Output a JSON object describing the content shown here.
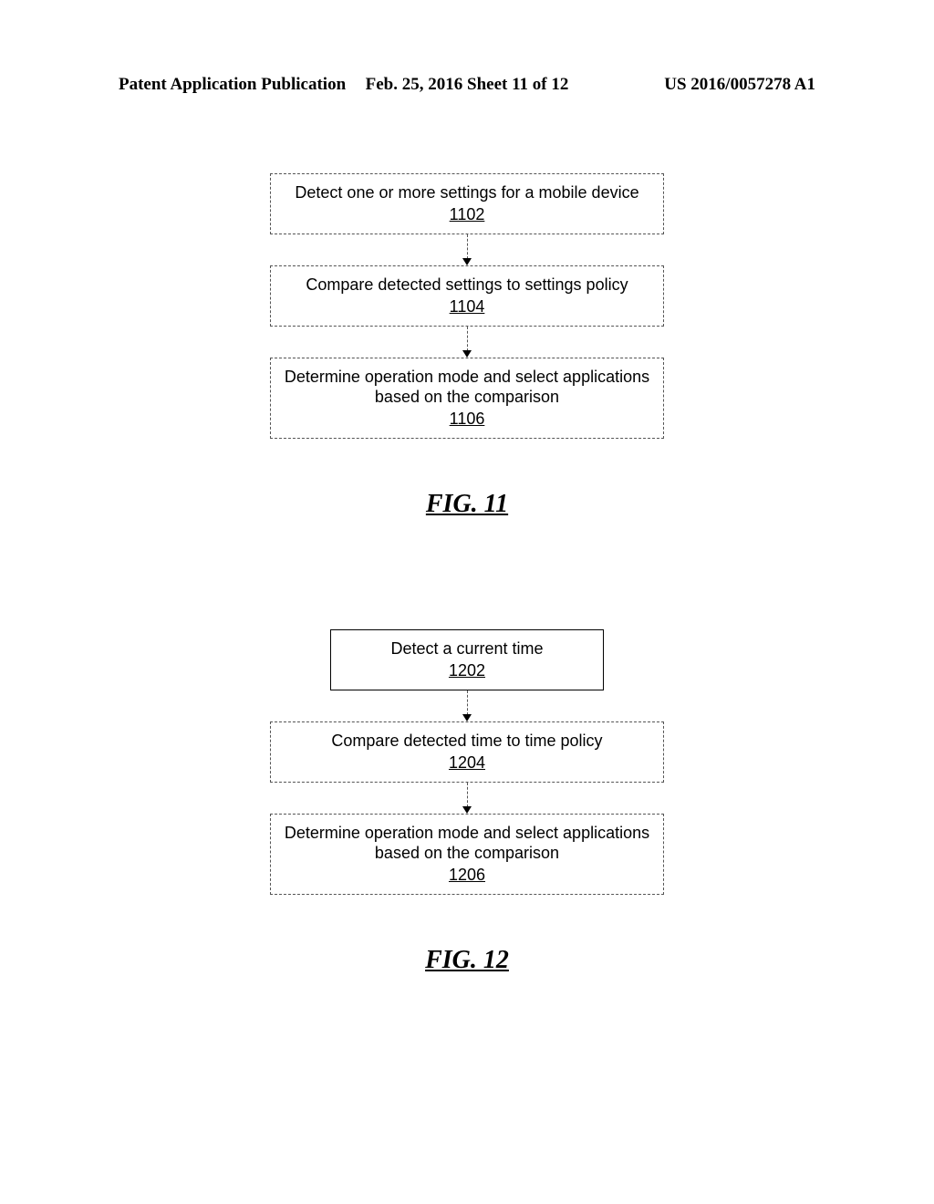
{
  "header": {
    "left": "Patent Application Publication",
    "center": "Feb. 25, 2016  Sheet 11 of 12",
    "right": "US 2016/0057278 A1"
  },
  "fig11": {
    "label": "FIG. 11",
    "steps": [
      {
        "text": "Detect one or more settings for a mobile device",
        "num": "1102"
      },
      {
        "text": "Compare detected settings to settings policy",
        "num": "1104"
      },
      {
        "text": "Determine operation mode and select applications based on the comparison",
        "num": "1106"
      }
    ]
  },
  "fig12": {
    "label": "FIG. 12",
    "steps": [
      {
        "text": "Detect a current time",
        "num": "1202"
      },
      {
        "text": "Compare detected time to time policy",
        "num": "1204"
      },
      {
        "text": "Determine operation mode and select applications based on the comparison",
        "num": "1206"
      }
    ]
  }
}
